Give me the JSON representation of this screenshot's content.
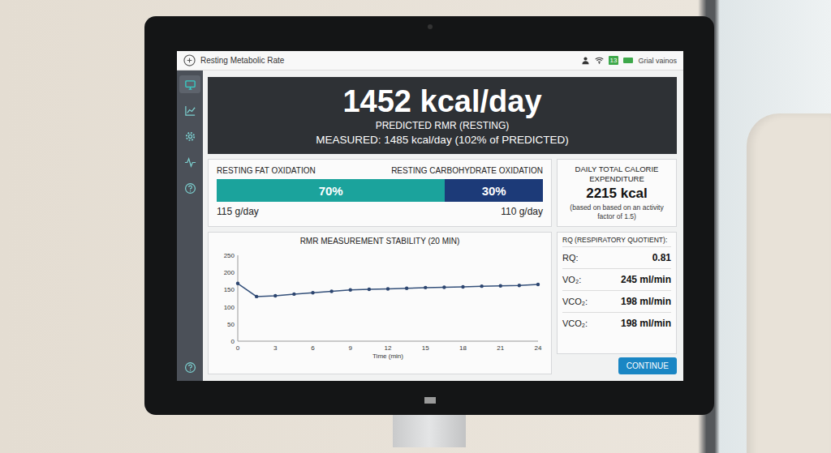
{
  "header": {
    "title": "Resting Metabolic Rate",
    "battery": "13",
    "status_text": "Grial vainos"
  },
  "sidebar": {
    "items": [
      {
        "selected": true
      },
      {
        "selected": false
      },
      {
        "selected": false
      },
      {
        "selected": false
      },
      {
        "selected": false
      },
      {
        "selected": false
      }
    ]
  },
  "hero": {
    "value": "1452 kcal/day",
    "label": "PREDICTED RMR (RESTING)",
    "measured": "MEASURED: 1485 kcal/day (102% of PREDICTED)"
  },
  "oxidation": {
    "segments": [
      {
        "name": "RESTING FAT OXIDATION",
        "label": "70%",
        "level": 0.7,
        "amount": "115 g/day",
        "color": "#1ba39c"
      },
      {
        "name": "RESTING CARBOHYDRATE OXIDATION",
        "label": "30%",
        "level": 0.3,
        "amount": "110 g/day",
        "color": "#1c3a78"
      }
    ]
  },
  "expenditure": {
    "title": "DAILY TOTAL CALORIE EXPENDITURE",
    "value": "2215 kcal",
    "note": "(based on based on an activity factor of 1.5)"
  },
  "chart": {
    "title": "RMR MEASUREMENT STABILITY (20 MIN)",
    "y_ticks": [
      "0",
      "50",
      "100",
      "150",
      "200",
      "250"
    ],
    "x_ticks": [
      "0",
      "3",
      "6",
      "9",
      "12",
      "15",
      "18",
      "21",
      "24"
    ],
    "x_label": "Time (min)",
    "series": [
      {
        "values": [
          168,
          130,
          132,
          137,
          141,
          145,
          149,
          151,
          152,
          154,
          156,
          157,
          158,
          160,
          161,
          162,
          165
        ]
      }
    ]
  },
  "gas": {
    "title": "RQ (RESPIRATORY QUOTIENT):",
    "rows": [
      {
        "label": "RQ:",
        "value": "0.81"
      },
      {
        "label": "VO₂:",
        "value": "245 ml/min"
      },
      {
        "label": "VCO₂:",
        "value": "198 ml/min"
      },
      {
        "label": "VCO₂:",
        "value": "198 ml/min"
      }
    ]
  },
  "buttons": [
    "CONTINUE"
  ]
}
